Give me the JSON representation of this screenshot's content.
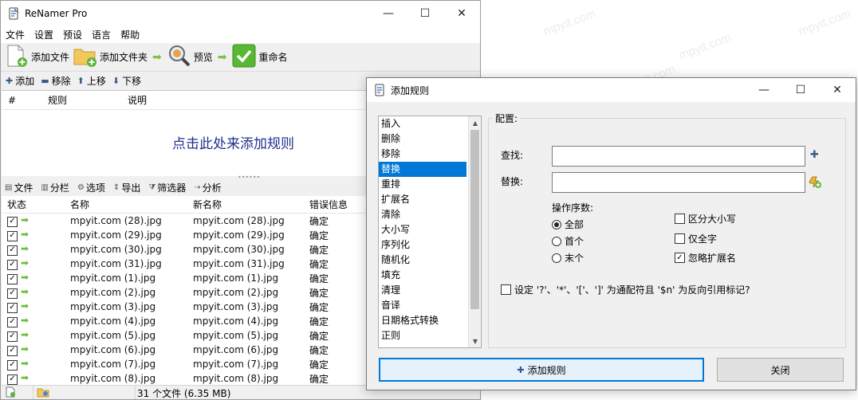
{
  "watermark": "mpyit.com",
  "main_window": {
    "title": "ReNamer Pro",
    "window_buttons": [
      "—",
      "☐",
      "✕"
    ],
    "menu": [
      "文件",
      "设置",
      "预设",
      "语言",
      "帮助"
    ],
    "toolbar": {
      "add_files": "添加文件",
      "add_folders": "添加文件夹",
      "preview": "预览",
      "rename": "重命名"
    },
    "rule_toolbar": {
      "add": "添加",
      "remove": "移除",
      "move_up": "上移",
      "move_down": "下移"
    },
    "rules_columns": [
      "#",
      "规则",
      "说明"
    ],
    "rules_empty": "点击此处来添加规则",
    "file_toolbar": [
      "文件",
      "分栏",
      "选项",
      "导出",
      "筛选器",
      "分析"
    ],
    "file_columns": [
      "状态",
      "名称",
      "新名称",
      "错误信息"
    ],
    "files": [
      {
        "name": "mpyit.com (28).jpg",
        "new_name": "mpyit.com (28).jpg",
        "error": "确定"
      },
      {
        "name": "mpyit.com (29).jpg",
        "new_name": "mpyit.com (29).jpg",
        "error": "确定"
      },
      {
        "name": "mpyit.com (30).jpg",
        "new_name": "mpyit.com (30).jpg",
        "error": "确定"
      },
      {
        "name": "mpyit.com (31).jpg",
        "new_name": "mpyit.com (31).jpg",
        "error": "确定"
      },
      {
        "name": "mpyit.com (1).jpg",
        "new_name": "mpyit.com (1).jpg",
        "error": "确定"
      },
      {
        "name": "mpyit.com (2).jpg",
        "new_name": "mpyit.com (2).jpg",
        "error": "确定"
      },
      {
        "name": "mpyit.com (3).jpg",
        "new_name": "mpyit.com (3).jpg",
        "error": "确定"
      },
      {
        "name": "mpyit.com (4).jpg",
        "new_name": "mpyit.com (4).jpg",
        "error": "确定"
      },
      {
        "name": "mpyit.com (5).jpg",
        "new_name": "mpyit.com (5).jpg",
        "error": "确定"
      },
      {
        "name": "mpyit.com (6).jpg",
        "new_name": "mpyit.com (6).jpg",
        "error": "确定"
      },
      {
        "name": "mpyit.com (7).jpg",
        "new_name": "mpyit.com (7).jpg",
        "error": "确定"
      },
      {
        "name": "mpyit.com (8).jpg",
        "new_name": "mpyit.com (8).jpg",
        "error": "确定"
      }
    ],
    "status_text": "31 个文件 (6.35 MB)"
  },
  "dialog": {
    "title": "添加规则",
    "window_buttons": [
      "—",
      "☐",
      "✕"
    ],
    "rule_types": [
      "插入",
      "删除",
      "移除",
      "替换",
      "重排",
      "扩展名",
      "清除",
      "大小写",
      "序列化",
      "随机化",
      "填充",
      "清理",
      "音译",
      "日期格式转换",
      "正则"
    ],
    "selected_rule": "替换",
    "config_label": "配置:",
    "find_label": "查找:",
    "find_value": "",
    "replace_label": "替换:",
    "replace_value": "",
    "occurrence_label": "操作序数:",
    "occurrences": [
      {
        "label": "全部",
        "selected": true
      },
      {
        "label": "首个",
        "selected": false
      },
      {
        "label": "末个",
        "selected": false
      }
    ],
    "options": [
      {
        "label": "区分大小写",
        "checked": false
      },
      {
        "label": "仅全字",
        "checked": false
      },
      {
        "label": "忽略扩展名",
        "checked": true
      }
    ],
    "wildcard_label": "设定 '?'、'*'、'['、']' 为通配符且 '$n' 为反向引用标记?",
    "wildcard_checked": false,
    "add_button": "添加规则",
    "close_button": "关闭"
  },
  "colors": {
    "selection": "#0078d7",
    "link_blue": "#1e2f8c",
    "green_arrow": "#6abf3a"
  }
}
